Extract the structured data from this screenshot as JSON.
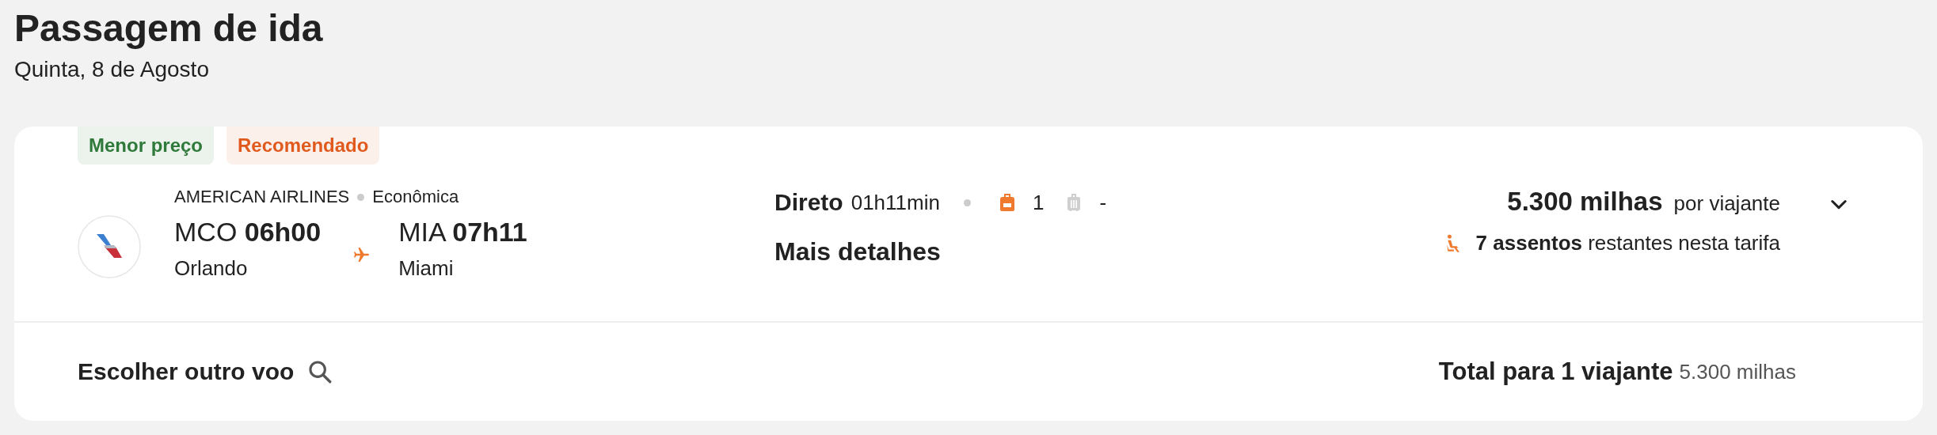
{
  "header": {
    "title": "Passagem de ida",
    "date": "Quinta, 8 de Agosto"
  },
  "flight": {
    "tags": [
      {
        "label": "Menor preço",
        "color": "#2f7a3a"
      },
      {
        "label": "Recomendado",
        "color": "#e05a1e"
      }
    ],
    "airline": "AMERICAN AIRLINES",
    "cabin": "Econômica",
    "origin": {
      "code": "MCO",
      "time": "06h00",
      "city": "Orlando"
    },
    "destination": {
      "code": "MIA",
      "time": "07h11",
      "city": "Miami"
    },
    "stops": "Direto",
    "duration": "01h11min",
    "baggage": [
      {
        "kind": "backpack",
        "included": true,
        "count": "1"
      },
      {
        "kind": "suitcase",
        "included": false,
        "count": "-"
      }
    ],
    "details_link": "Mais detalhes",
    "price": "5.300 milhas",
    "price_note": "por viajante",
    "seats": "**7 assentos** restantes nesta tarifa",
    "expanded": false
  },
  "footer": {
    "change_link": "Escolher outro voo",
    "total_label": "Total para 1 viajante",
    "total_value": "5.300 milhas"
  }
}
